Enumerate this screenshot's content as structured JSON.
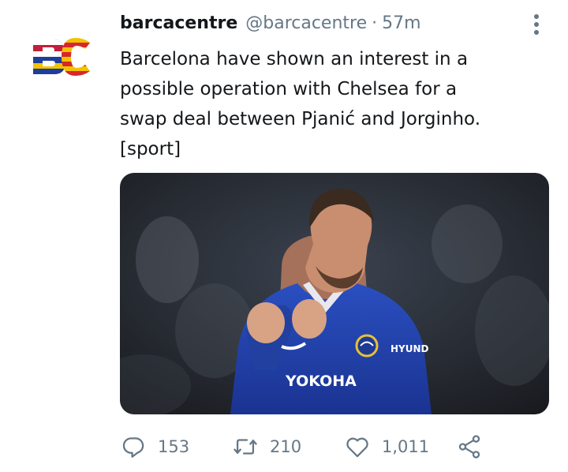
{
  "tweet": {
    "author_name": "barcacentre",
    "handle": "@barcacentre",
    "separator": "·",
    "time": "57m",
    "text_lines": [
      "Barcelona have shown an interest in a",
      "possible operation with Chelsea for a",
      "swap deal between Pjanić and Jorginho.",
      "[sport]"
    ],
    "media": {
      "shirt_sponsor": "YOKOHA",
      "sleeve_sponsor": "HYUND"
    }
  },
  "avatar": {
    "logo_text": "BC"
  },
  "actions": {
    "replies": "153",
    "retweets": "210",
    "likes": "1,011"
  },
  "icons": {
    "more": "more-vertical-icon",
    "reply": "reply-icon",
    "retweet": "retweet-icon",
    "like": "heart-icon",
    "share": "share-icon"
  },
  "colors": {
    "text_primary": "#14171a",
    "text_secondary": "#657786",
    "kit_blue": "#1b3ea6"
  }
}
